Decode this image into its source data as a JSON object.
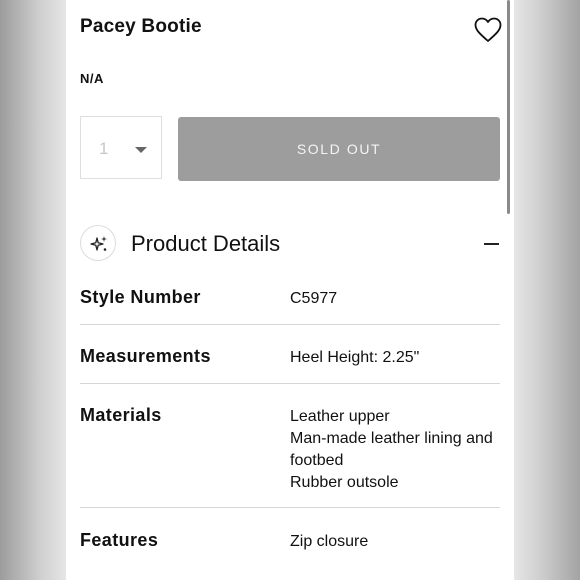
{
  "product": {
    "title": "Pacey Bootie",
    "variant": "N/A",
    "quantity": "1",
    "sold_out_label": "SOLD OUT",
    "wishlist_icon": "heart-outline-icon"
  },
  "details": {
    "title": "Product Details",
    "icon": "sparkle-icon",
    "toggle_icon": "minus-icon",
    "rows": [
      {
        "label": "Style Number",
        "values": [
          "C5977"
        ]
      },
      {
        "label": "Measurements",
        "values": [
          "Heel Height: 2.25\""
        ]
      },
      {
        "label": "Materials",
        "values": [
          "Leather upper",
          "Man-made leather lining and footbed",
          "Rubber outsole"
        ]
      },
      {
        "label": "Features",
        "values": [
          "Zip closure"
        ]
      }
    ]
  }
}
